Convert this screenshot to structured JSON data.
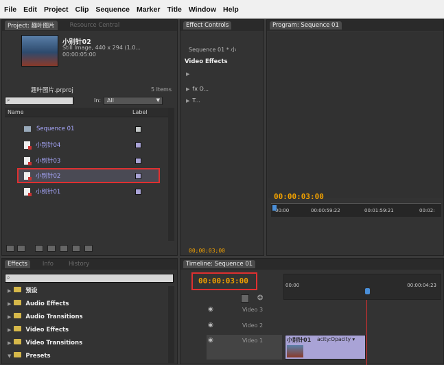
{
  "menu": [
    "File",
    "Edit",
    "Project",
    "Clip",
    "Sequence",
    "Marker",
    "Title",
    "Window",
    "Help"
  ],
  "project_panel": {
    "tabs": [
      "Project: 趣叶图片",
      "Resource Central"
    ],
    "clip_name": "小别针02",
    "clip_info": "Still Image, 440 x 294 (1.0...",
    "clip_duration": "00:00:05:00",
    "project_file": "趣叶图片.prproj",
    "item_count": "5 Items",
    "in_label": "In:",
    "in_value": "All",
    "col_name": "Name",
    "col_label": "Label",
    "items": [
      {
        "name": "Sequence 01",
        "color": "#c4c8c8"
      },
      {
        "name": "小别针04",
        "color": "#a9a3d6"
      },
      {
        "name": "小别针03",
        "color": "#a9a3d6"
      },
      {
        "name": "小别针02",
        "color": "#a9a3d6"
      },
      {
        "name": "小别针01",
        "color": "#a9a3d6"
      }
    ]
  },
  "effect_controls": {
    "tab": "Effect Controls",
    "sequence": "Sequence 01 * 小",
    "video_effects": "Video Effects",
    "rows": [
      "",
      "O...",
      "T..."
    ],
    "timecode": "00;00;03;00"
  },
  "program": {
    "tab": "Program: Sequence 01",
    "timecode": "00:00:03:00",
    "ruler": [
      "00:00",
      "00:00:59:22",
      "00:01:59:21",
      "00:02:"
    ]
  },
  "effects_panel": {
    "tabs": [
      "Effects",
      "Info",
      "History"
    ],
    "items": [
      "预设",
      "Audio Effects",
      "Audio Transitions",
      "Video Effects",
      "Video Transitions",
      "Presets"
    ]
  },
  "timeline": {
    "tab": "Timeline: Sequence 01",
    "timecode": "00:00:03:00",
    "ruler_start": "00:00",
    "ruler_end": "00:00:04:23",
    "tracks": [
      "Video 3",
      "Video 2",
      "Video 1"
    ],
    "clip_label": "小别针01",
    "clip_suffix": "acity:Opacity ▾"
  },
  "colors": {
    "highlight": "#e03030",
    "timecode": "#f0a000",
    "playhead": "#4a8fd8"
  }
}
